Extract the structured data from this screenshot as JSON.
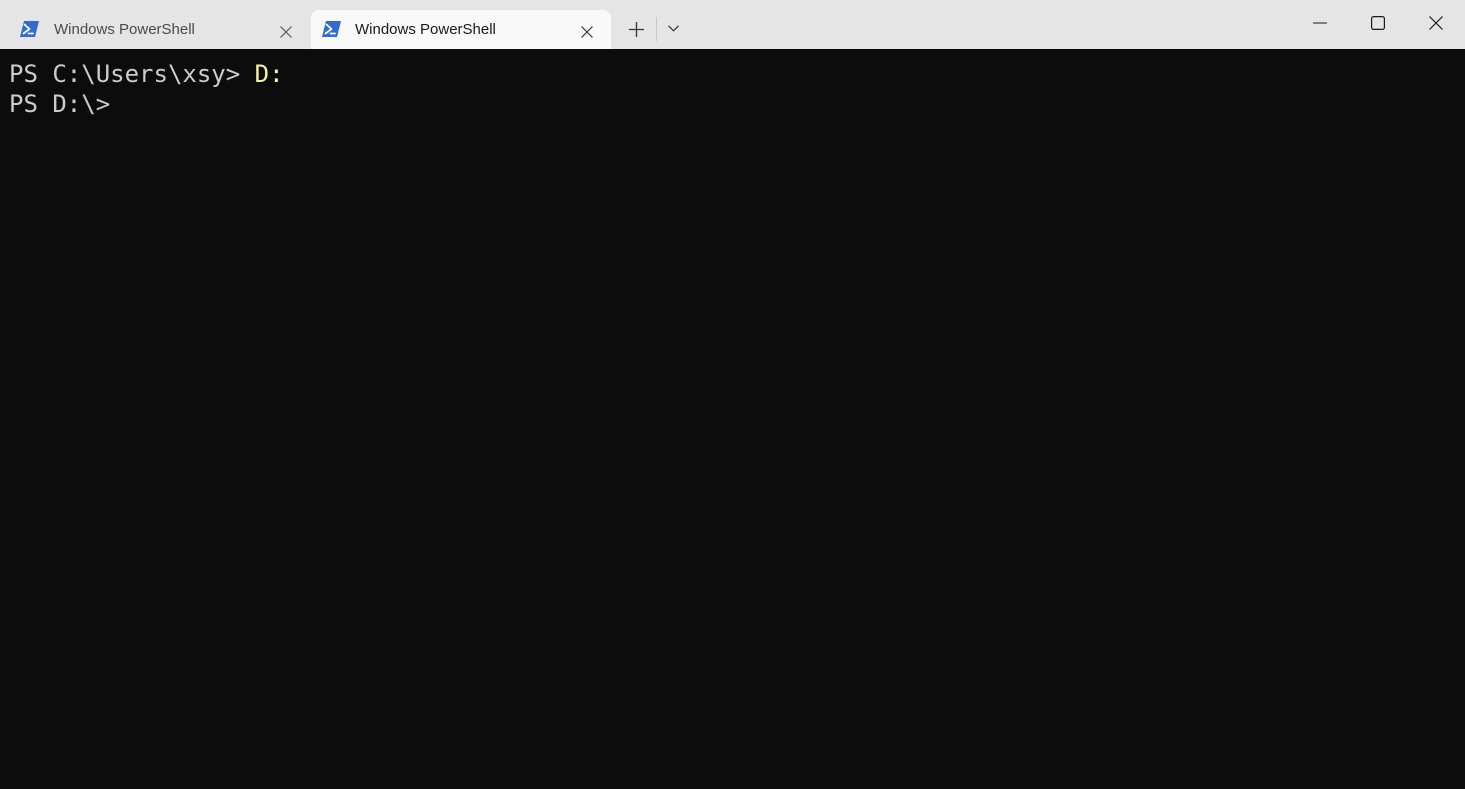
{
  "window": {
    "tabs": [
      {
        "label": "Windows PowerShell",
        "active": false,
        "icon": "powershell-icon"
      },
      {
        "label": "Windows PowerShell",
        "active": true,
        "icon": "powershell-icon"
      }
    ],
    "controls": {
      "new_tab_icon": "plus-icon",
      "dropdown_icon": "chevron-down-icon",
      "minimize_icon": "minimize-icon",
      "maximize_icon": "maximize-icon",
      "close_icon": "close-icon"
    },
    "colors": {
      "titlebar_bg": "#e5e5e5",
      "active_tab_bg": "#f9f9f9",
      "terminal_bg": "#0c0c0c",
      "terminal_fg": "#cccccc",
      "command_fg": "#f9f1a5",
      "powershell_icon": "#2f6bd1"
    }
  },
  "terminal": {
    "lines": [
      {
        "prompt": "PS C:\\Users\\xsy> ",
        "command": "D:"
      },
      {
        "prompt": "PS D:\\>",
        "command": ""
      }
    ]
  }
}
